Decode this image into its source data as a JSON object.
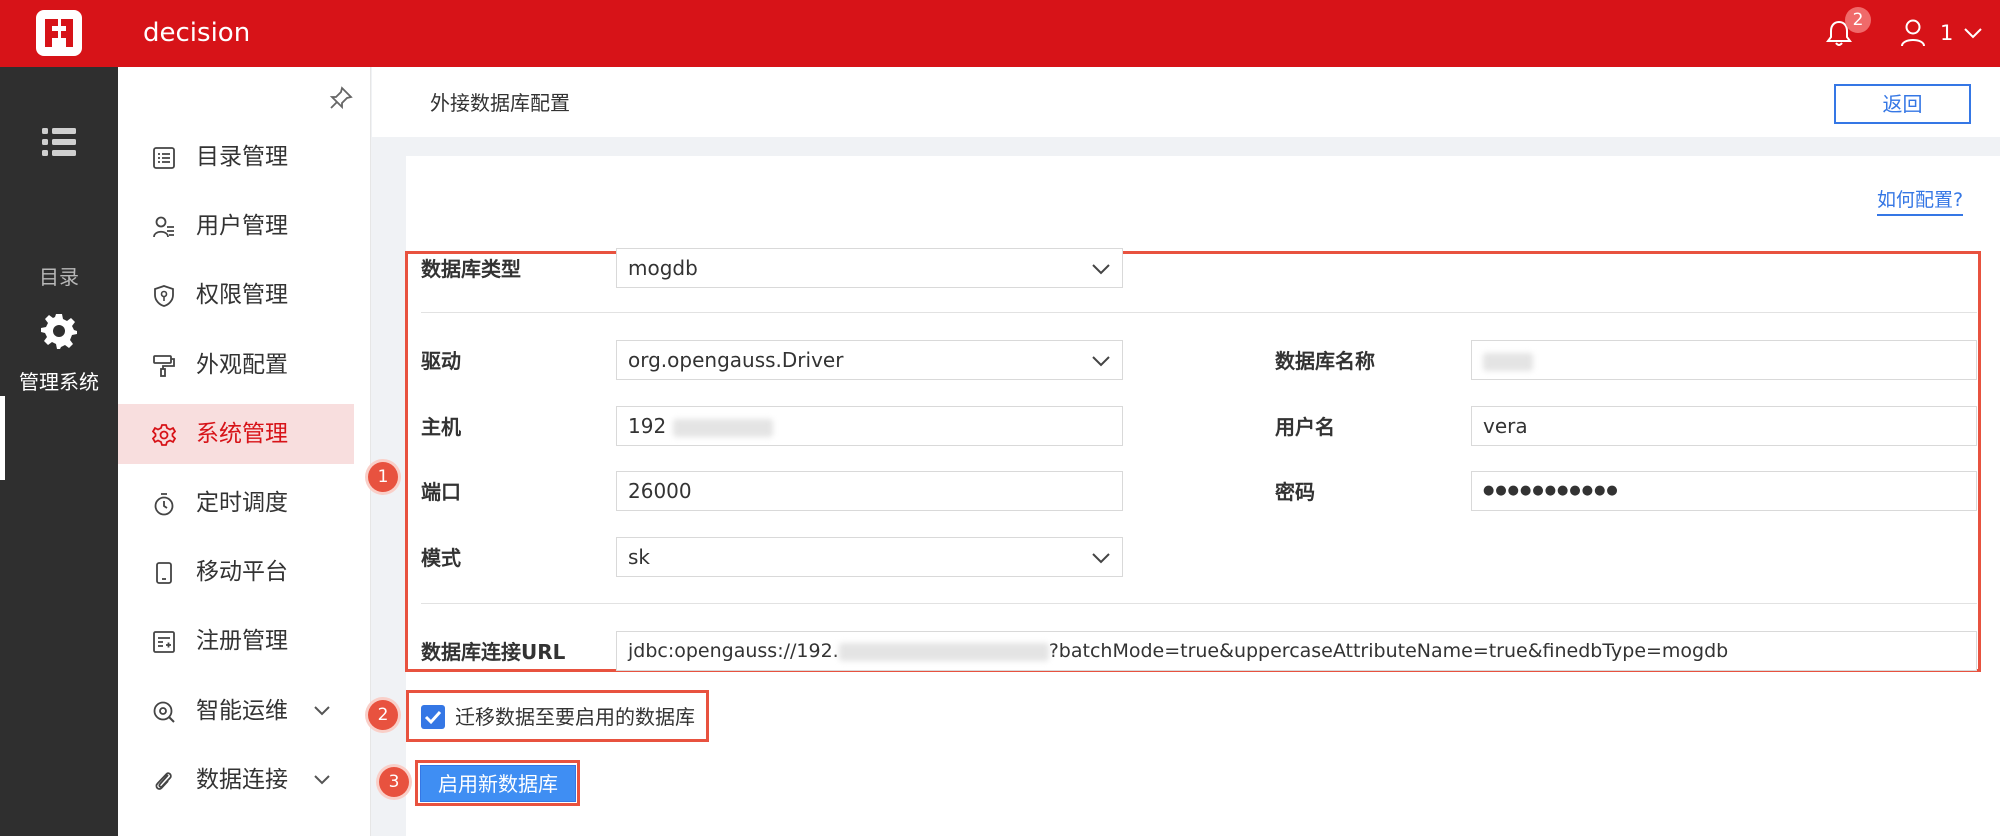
{
  "topbar": {
    "app_title": "decision",
    "notification_count": "2",
    "user_name": "1"
  },
  "rail": {
    "items": [
      {
        "label": "目录",
        "icon": "list-icon"
      },
      {
        "label": "管理系统",
        "icon": "gear-icon"
      }
    ]
  },
  "subnav": {
    "items": [
      {
        "label": "目录管理",
        "icon": "catalog-icon"
      },
      {
        "label": "用户管理",
        "icon": "user-manage-icon"
      },
      {
        "label": "权限管理",
        "icon": "shield-icon"
      },
      {
        "label": "外观配置",
        "icon": "paint-roller-icon"
      },
      {
        "label": "系统管理",
        "icon": "settings-icon",
        "active": true
      },
      {
        "label": "定时调度",
        "icon": "timer-icon"
      },
      {
        "label": "移动平台",
        "icon": "mobile-icon"
      },
      {
        "label": "注册管理",
        "icon": "register-icon"
      },
      {
        "label": "智能运维",
        "icon": "ops-icon",
        "expandable": true
      },
      {
        "label": "数据连接",
        "icon": "paperclip-icon",
        "expandable": true
      }
    ]
  },
  "header": {
    "title": "外接数据库配置",
    "back_label": "返回"
  },
  "form": {
    "help_link": "如何配置?",
    "db_type": {
      "label": "数据库类型",
      "value": "mogdb"
    },
    "driver": {
      "label": "驱动",
      "value": "org.opengauss.Driver"
    },
    "host": {
      "label": "主机",
      "value": "192"
    },
    "port": {
      "label": "端口",
      "value": "26000"
    },
    "schema": {
      "label": "模式",
      "value": "sk"
    },
    "db_name": {
      "label": "数据库名称",
      "value": ""
    },
    "username": {
      "label": "用户名",
      "value": "vera"
    },
    "password": {
      "label": "密码",
      "value": "●●●●●●●●●●●"
    },
    "url": {
      "label": "数据库连接URL",
      "prefix": "jdbc:opengauss://192.",
      "suffix": "?batchMode=true&uppercaseAttributeName=true&finedbType=mogdb"
    }
  },
  "migrate": {
    "label": "迁移数据至要启用的数据库",
    "checked": true
  },
  "enable_button": {
    "label": "启用新数据库"
  },
  "steps": [
    "1",
    "2",
    "3"
  ],
  "colors": {
    "brand_red": "#d71318",
    "accent_blue": "#3577e5",
    "highlight_red": "#e8523f"
  }
}
